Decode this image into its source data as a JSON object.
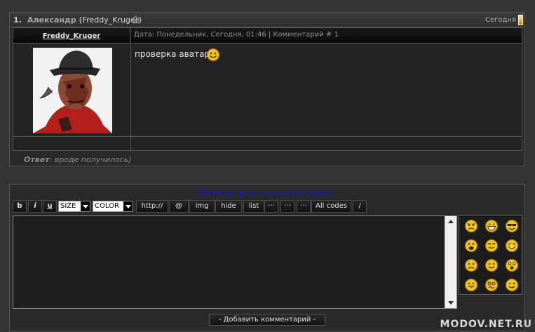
{
  "comment": {
    "number": "1.",
    "author_name": "Александр",
    "author_login": "Freddy_Kruger",
    "day_label": "Сегодня",
    "user_link": "Freddy_Kruger",
    "meta": "Дата: Понедельник, Сегодня, 01:46 | Комментарий # 1",
    "text": "проверка аватара",
    "reply_label": "Ответ",
    "reply_text": ": вроде получилось)"
  },
  "form": {
    "success_message": "Комментарий успешно добавлен",
    "toolbar": {
      "bold": "b",
      "italic": "i",
      "underline": "u",
      "size": "SIZE",
      "color": "COLOR",
      "url": "http://",
      "email": "@",
      "img": "img",
      "hide": "hide",
      "list": "list",
      "more1": "···",
      "more2": "···",
      "more3": "···",
      "all_codes": "All codes",
      "slash": "/"
    },
    "textarea_value": "",
    "submit_label": "- Добавить комментарий -"
  },
  "smileys": [
    "angry-smiley",
    "biggrin-smiley",
    "cool-smiley",
    "cry-smiley",
    "happy-smiley",
    "laugh-smiley",
    "sad-smiley",
    "smile-smiley",
    "surprised-smiley",
    "tongue-smiley",
    "wacko-smiley",
    "wink-smiley"
  ],
  "watermark": "MODOV.NET.RU",
  "colors": {
    "background": "#343434",
    "panel": "#2a2a2a",
    "success": "#1a1acc",
    "smiley": "#f2c417"
  }
}
